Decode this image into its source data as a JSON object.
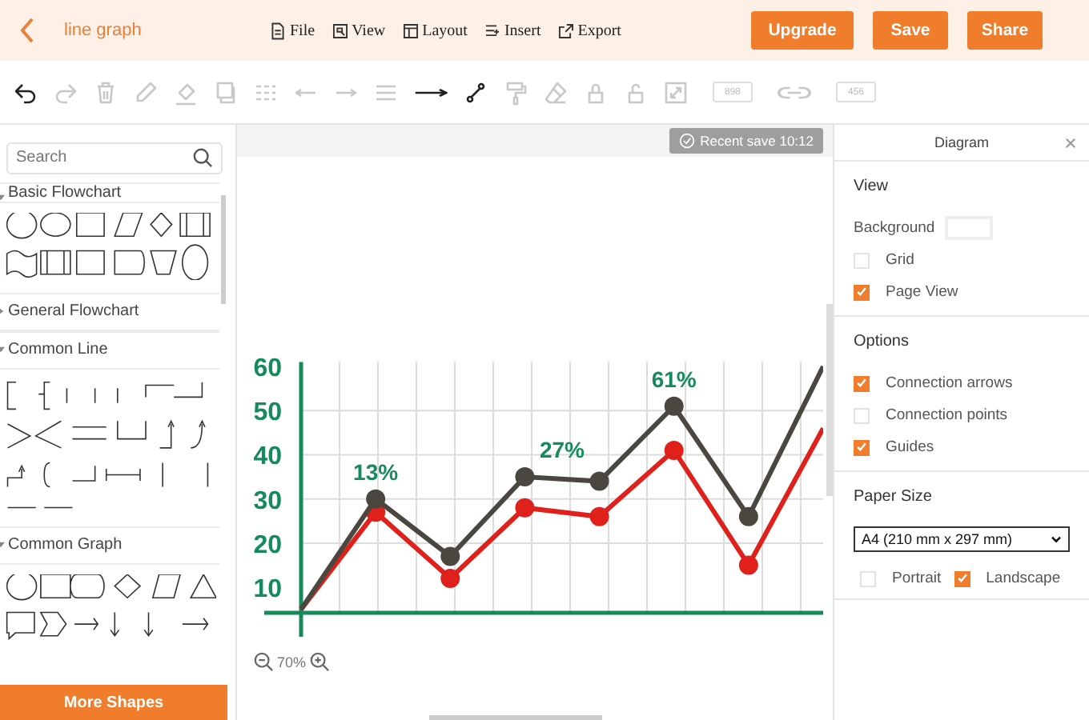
{
  "header": {
    "title": "line graph",
    "menu": [
      {
        "label": "File",
        "kind": "file"
      },
      {
        "label": "View",
        "kind": "view"
      },
      {
        "label": "Layout",
        "kind": "layout"
      },
      {
        "label": "Insert",
        "kind": "insert"
      },
      {
        "label": "Export",
        "kind": "export"
      }
    ],
    "buttons": [
      "Upgrade",
      "Save",
      "Share"
    ]
  },
  "toolbar": [
    {
      "kind": "undo",
      "disabled": false
    },
    {
      "kind": "redo",
      "disabled": true
    },
    {
      "kind": "delete",
      "disabled": true
    },
    {
      "kind": "pencil",
      "disabled": true
    },
    {
      "kind": "fill",
      "disabled": true
    },
    {
      "kind": "shadow",
      "disabled": true
    },
    {
      "kind": "dashes",
      "disabled": true
    },
    {
      "kind": "arrow-left",
      "disabled": true
    },
    {
      "kind": "arrow-right",
      "disabled": true
    },
    {
      "kind": "lines",
      "disabled": true
    },
    {
      "kind": "arrow",
      "disabled": false
    },
    {
      "kind": "connector",
      "disabled": false
    },
    {
      "kind": "roller",
      "disabled": true
    },
    {
      "kind": "eraser",
      "disabled": true
    },
    {
      "kind": "lock",
      "disabled": true
    },
    {
      "kind": "unlock",
      "disabled": true
    },
    {
      "kind": "resize",
      "disabled": true
    },
    {
      "kind": "number-box",
      "text": "898",
      "disabled": true
    },
    {
      "kind": "link",
      "disabled": true
    },
    {
      "kind": "number-box",
      "text": "456",
      "disabled": true
    }
  ],
  "sidebar": {
    "search": {
      "placeholder": "Search"
    },
    "sections": [
      {
        "title": "Basic Flowchart",
        "expanded": true,
        "kind": "flowchart"
      },
      {
        "title": "General Flowchart",
        "expanded": false
      },
      {
        "title": "Common Line",
        "expanded": true,
        "kind": "line"
      },
      {
        "title": "Common Graph",
        "expanded": true,
        "kind": "graph"
      }
    ],
    "more_button": "More Shapes"
  },
  "canvas": {
    "save_status": "Recent save 10:12",
    "zoom": "70%",
    "chart_data": {
      "type": "line",
      "categories": [
        null,
        null,
        null,
        null,
        null,
        null,
        null,
        null
      ],
      "ylim": [
        4,
        61
      ],
      "grid": true,
      "yticks": [
        10,
        20,
        30,
        40,
        50,
        60
      ],
      "series": [
        {
          "color": "#4a4740",
          "values": [
            5,
            30,
            17,
            35,
            34,
            51,
            26,
            60
          ]
        },
        {
          "color": "#e0201a",
          "values": [
            5,
            27,
            12,
            28,
            26,
            41,
            15,
            46
          ]
        }
      ],
      "annotations": [
        {
          "text": "13%"
        },
        {
          "text": "27%"
        },
        {
          "text": "61%"
        }
      ]
    }
  },
  "panel": {
    "title": "Diagram",
    "sections": [
      {
        "title": "View",
        "background_label": "Background",
        "options": [
          {
            "label": "Grid",
            "checked": false
          },
          {
            "label": "Page View",
            "checked": true
          }
        ]
      },
      {
        "title": "Options",
        "options": [
          {
            "label": "Connection arrows",
            "checked": true
          },
          {
            "label": "Connection points",
            "checked": false
          },
          {
            "label": "Guides",
            "checked": true
          }
        ]
      }
    ],
    "paper": {
      "title": "Paper Size",
      "value": "A4 (210 mm x 297 mm)",
      "orientations": [
        {
          "label": "Portrait",
          "checked": false
        },
        {
          "label": "Landscape",
          "checked": true
        }
      ]
    }
  }
}
